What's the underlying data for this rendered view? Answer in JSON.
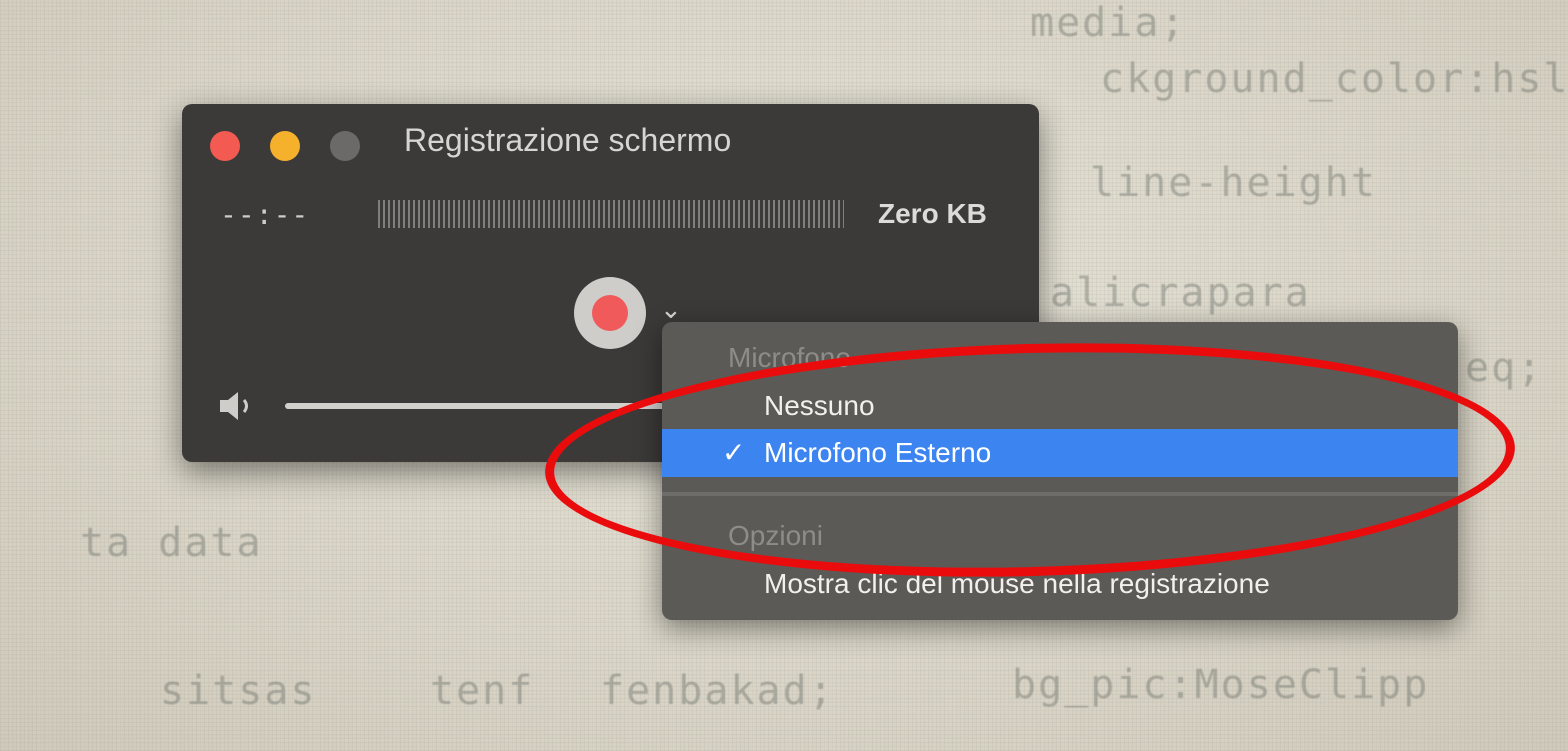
{
  "window": {
    "title": "Registrazione schermo",
    "timecode": "--:--",
    "filesize": "Zero KB",
    "record_button": "record-icon",
    "options_chevron": "⌄",
    "volume_icon": "speaker-icon"
  },
  "menu": {
    "microphone_header": "Microfono",
    "items": [
      {
        "label": "Nessuno",
        "checked": false
      },
      {
        "label": "Microfono Esterno",
        "checked": true,
        "check_glyph": "✓"
      }
    ],
    "options_header": "Opzioni",
    "options_items": [
      {
        "label": "Mostra clic del mouse nella registrazione"
      }
    ]
  },
  "background_text": [
    "media;",
    "ckground_color:hsl",
    "line-height",
    "alicrapara",
    "ta data",
    "eq;",
    "bg_pic:MoseClipp",
    "sitsas",
    "tenf",
    "fenbakad;"
  ],
  "colors": {
    "selection": "#3c84f0",
    "annotation": "#ea0c0c",
    "close": "#f25a52",
    "minimize": "#f5b12b",
    "record": "#f05a5a"
  }
}
